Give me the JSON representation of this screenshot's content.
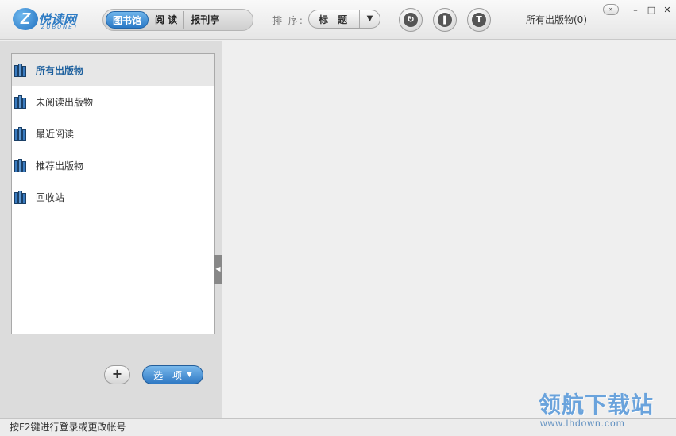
{
  "app": {
    "logo_text": "悦读网",
    "logo_subtext": "ZUBUNET",
    "logo_letter": "Z"
  },
  "toolbar": {
    "tabs": [
      {
        "label": "图书馆",
        "active": true
      },
      {
        "label": "阅 读",
        "active": false
      },
      {
        "label": "报刊亭",
        "active": false
      }
    ],
    "sort_label": "排 序:",
    "sort_value": "标 题",
    "sort_arrow": "▼",
    "collection_status": "所有出版物(0)",
    "expand_label": "»",
    "round_buttons": [
      {
        "icon": "refresh-book-icon",
        "glyph": "↻"
      },
      {
        "icon": "open-book-icon",
        "glyph": "❚"
      },
      {
        "icon": "text-t-icon",
        "glyph": "T"
      }
    ]
  },
  "window_controls": {
    "minimize": "–",
    "maximize": "□",
    "close": "✕"
  },
  "sidebar": {
    "items": [
      {
        "label": "所有出版物",
        "selected": true
      },
      {
        "label": "未阅读出版物",
        "selected": false
      },
      {
        "label": "最近阅读",
        "selected": false
      },
      {
        "label": "推荐出版物",
        "selected": false
      },
      {
        "label": "回收站",
        "selected": false
      }
    ],
    "add_button": "+",
    "options_button": "选 项",
    "options_caret": "▼",
    "collapse_glyph": "◀"
  },
  "statusbar": {
    "text": "按F2键进行登录或更改帐号"
  },
  "watermark": {
    "main": "领航下载站",
    "sub": "www.lhdown.com"
  },
  "colors": {
    "accent": "#2f79c4",
    "selected_text": "#1c5f9d"
  }
}
